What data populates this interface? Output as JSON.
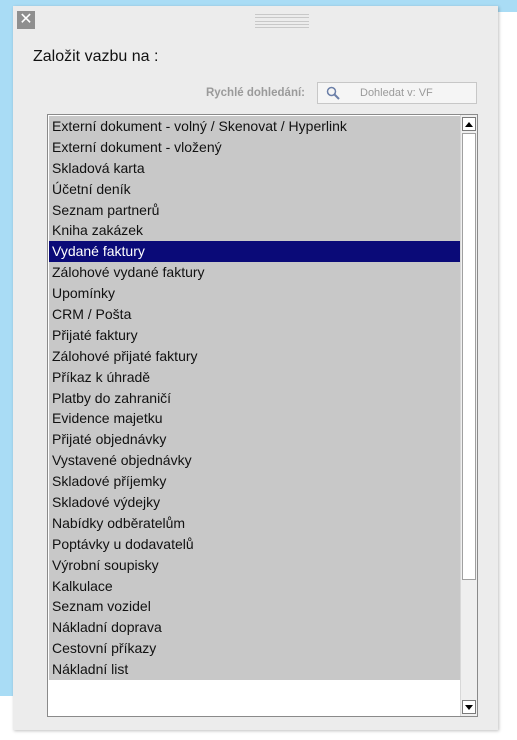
{
  "dialog": {
    "title": "Založit vazbu na :",
    "close_icon": "close-icon"
  },
  "search": {
    "label": "Rychlé dohledání:",
    "placeholder": "Dohledat v: VF",
    "icon": "search-icon"
  },
  "list": {
    "selected_index": 6,
    "items": [
      "Externí dokument - volný / Skenovat / Hyperlink",
      "Externí dokument - vložený",
      "Skladová karta",
      "Účetní deník",
      "Seznam partnerů",
      "Kniha zakázek",
      "Vydané faktury",
      "Zálohové vydané faktury",
      "Upomínky",
      "CRM / Pošta",
      "Přijaté faktury",
      "Zálohové přijaté faktury",
      "Příkaz k úhradě",
      "Platby do zahraničí",
      "Evidence majetku",
      "Přijaté objednávky",
      "Vystavené objednávky",
      "Skladové příjemky",
      "Skladové výdejky",
      "Nabídky odběratelům",
      "Poptávky u dodavatelů",
      "Výrobní soupisky",
      "Kalkulace",
      "Seznam vozidel",
      "Nákladní doprava",
      "Cestovní příkazy",
      "Nákladní list"
    ]
  },
  "colors": {
    "selection": "#0a0a78",
    "item_background": "#c8c8c8",
    "desktop_background": "#a9dcf5"
  }
}
